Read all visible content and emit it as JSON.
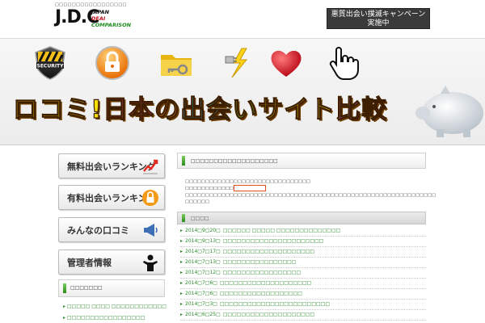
{
  "header": {
    "tagline": "□□□□□□□□□□□□□□□□□",
    "logo": "J.D.C",
    "logo_sub": [
      "JAPAN",
      "DEAI",
      "COMPARISON"
    ],
    "campaign_line1": "悪質出会い撲滅キャンペーン",
    "campaign_line2": "実施中"
  },
  "banner": {
    "icons": [
      "security-badge-icon",
      "padlock-icon",
      "folder-key-icon",
      "plug-lightning-icon",
      "heart-icon",
      "hand-cursor-icon"
    ],
    "security_text": "SECURITY",
    "title_chars": [
      "ロ",
      "コ",
      "ミ",
      "!",
      "日",
      "本",
      "の",
      "出",
      "会",
      "い",
      "サ",
      "イ",
      "ト",
      "比",
      "較"
    ],
    "title_colors": [
      "#f7e000",
      "#f7e000",
      "#f7e000",
      "#f7e000",
      "#f24a9a",
      "#f24a9a",
      "#ff8a1e",
      "#37c7e8",
      "#37c7e8",
      "#7bd63a",
      "#f7e000",
      "#f7e000",
      "#f7e000",
      "#c86ae0",
      "#c86ae0"
    ]
  },
  "sidebar": {
    "buttons": [
      {
        "label": "無料出会いランキング",
        "icon": "chart-up-icon"
      },
      {
        "label": "有料出会いランキング",
        "icon": "lock-icon"
      },
      {
        "label": "みんなの口コミ",
        "icon": "megaphone-icon"
      },
      {
        "label": "管理者情報",
        "icon": "person-silhouette-icon"
      }
    ],
    "section_title": "□□□□□□□",
    "links": [
      "□□□□□ □□□□ □□□□□□□□□□□□",
      "□□□□□□□□□□□□□□□□□"
    ]
  },
  "main": {
    "title": "□□□□□□□□□□□□□□□□□□□",
    "intro_line1": "□□□□□□□□□□□□□□□□□□□□□□□□□□□□□□□",
    "intro_line2a": "□□□□□□□□□□□□",
    "intro_line2b": "□□□□□□□□□□□□□□□□□□□□□□□□□□□□□□□□□□□□□□□□□□□□□□□□□□□□□□□□□□□□□□",
    "intro_line3": "□□□□□□",
    "news_title": "□□□□",
    "news": [
      {
        "date": "2014□9□20□",
        "text": "□□□□□□ □□□□□ □□□□□□□□□□□□□□"
      },
      {
        "date": "2014□9□13□",
        "text": "□□□□□□□□□□□□□□□□□□□□□□"
      },
      {
        "date": "2014□7□17□",
        "text": "□□□□□□□□□□□□□□□□□□□□"
      },
      {
        "date": "2014□7□13□",
        "text": "□□□□□□□□□□□□□□□□"
      },
      {
        "date": "2014□7□12□",
        "text": "□□□□□□□□□□□□□□□□□"
      },
      {
        "date": "2014□7□6□",
        "text": "□□□□□□□□□□□□□□□□□□□□"
      },
      {
        "date": "2014□7□6□",
        "text": "□□□□□□□□□□□□□□□□□□"
      },
      {
        "date": "2014□7□3□",
        "text": "□□□□□□□□□□□□□□□□□□□□□□□□"
      },
      {
        "date": "2014□6□25□",
        "text": "□□□□□□□□□□□□□□□□□□□□"
      }
    ]
  }
}
